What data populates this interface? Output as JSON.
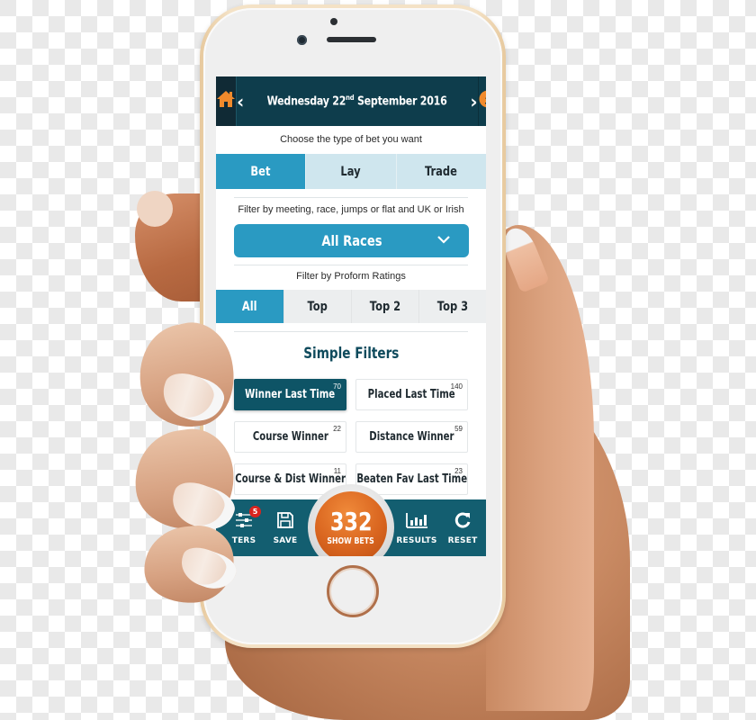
{
  "header": {
    "home_icon": "home-icon",
    "prev_icon": "chevron-left-icon",
    "date_weekday_day": "Wednesday 22",
    "date_suffix": "nd",
    "date_month_year": "September 2016",
    "next_icon": "chevron-right-icon",
    "info_icon": "info-icon"
  },
  "bet_type": {
    "caption": "Choose the type of bet you want",
    "tabs": [
      {
        "label": "Bet",
        "active": true
      },
      {
        "label": "Lay",
        "active": false
      },
      {
        "label": "Trade",
        "active": false
      }
    ]
  },
  "race_filter": {
    "caption": "Filter by meeting, race, jumps or flat and UK or Irish",
    "selected": "All Races",
    "chevron_icon": "chevron-down-icon"
  },
  "ratings": {
    "caption": "Filter by Proform Ratings",
    "tabs": [
      {
        "label": "All",
        "active": true
      },
      {
        "label": "Top",
        "active": false
      },
      {
        "label": "Top 2",
        "active": false
      },
      {
        "label": "Top 3",
        "active": false
      }
    ]
  },
  "simple_filters": {
    "title": "Simple Filters",
    "items": [
      {
        "label": "Winner Last Time",
        "count": "70",
        "active": true
      },
      {
        "label": "Placed Last Time",
        "count": "140",
        "active": false
      },
      {
        "label": "Course Winner",
        "count": "22",
        "active": false
      },
      {
        "label": "Distance Winner",
        "count": "59",
        "active": false
      },
      {
        "label": "Course & Dist Winner",
        "count": "11",
        "active": false
      },
      {
        "label": "Beaten Fav Last Time",
        "count": "23",
        "active": false
      }
    ]
  },
  "bottom_bar": {
    "filters": {
      "label": "FILTERS",
      "visible_label": "TERS",
      "badge": "5",
      "icon": "sliders-icon"
    },
    "save": {
      "label": "SAVE",
      "icon": "floppy-disk-icon"
    },
    "show_bets": {
      "count": "332",
      "label": "SHOW BETS"
    },
    "results": {
      "label": "RESULTS",
      "icon": "bar-chart-icon"
    },
    "reset": {
      "label": "RESET",
      "icon": "refresh-icon"
    }
  },
  "colors": {
    "header_bg": "#0e3d4c",
    "accent_blue": "#2a9ac2",
    "inactive_tab": "#cfe6ee",
    "active_filter": "#0e5466",
    "bottom_bar": "#135e70",
    "show_bets_orange": "#d9651f",
    "icon_orange": "#f08a2c",
    "badge_red": "#d9241f"
  }
}
